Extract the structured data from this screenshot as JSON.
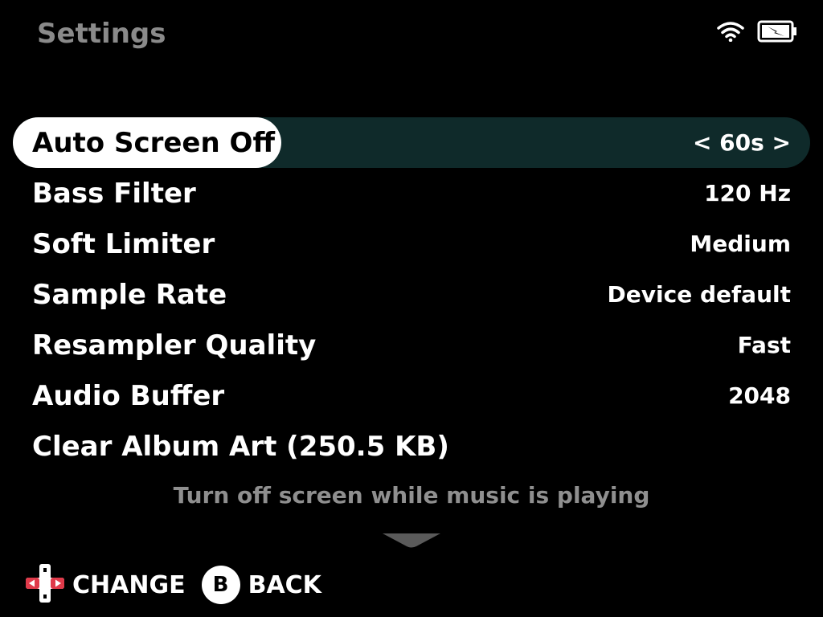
{
  "header": {
    "title": "Settings",
    "icons": [
      "wifi-icon",
      "battery-charging-icon"
    ]
  },
  "menu": {
    "items": [
      {
        "label": "Auto Screen Off",
        "value": "< 60s >",
        "selected": true
      },
      {
        "label": "Bass Filter",
        "value": "120 Hz"
      },
      {
        "label": "Soft Limiter",
        "value": "Medium"
      },
      {
        "label": "Sample Rate",
        "value": "Device default"
      },
      {
        "label": "Resampler Quality",
        "value": "Fast"
      },
      {
        "label": "Audio Buffer",
        "value": "2048"
      },
      {
        "label": "Clear Album Art (250.5 KB)",
        "value": ""
      }
    ]
  },
  "description": "Turn off screen while music is playing",
  "footer": {
    "change_label": "CHANGE",
    "b_button_glyph": "B",
    "back_label": "BACK"
  },
  "colors": {
    "background": "#000000",
    "selected_row": "#0f2a2a",
    "selected_pill": "#ffffff",
    "title": "#8a8a8a",
    "description": "#8f8f8f",
    "dpad_accent": "#e03a4a"
  }
}
